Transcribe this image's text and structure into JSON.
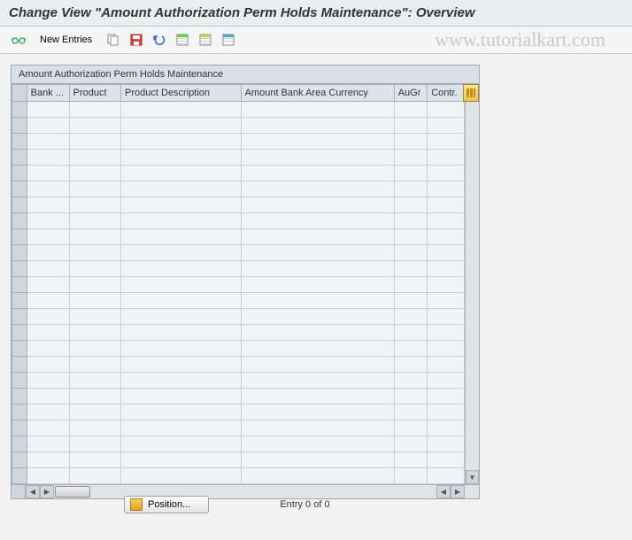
{
  "title": "Change View \"Amount Authorization Perm Holds Maintenance\": Overview",
  "toolbar": {
    "new_entries_label": "New Entries"
  },
  "watermark": "www.tutorialkart.com",
  "grid": {
    "title": "Amount Authorization Perm Holds Maintenance",
    "columns": [
      "Bank ...",
      "Product",
      "Product Description",
      "Amount Bank Area Currency",
      "AuGr",
      "Contr."
    ],
    "empty_rows": 24
  },
  "footer": {
    "position_label": "Position...",
    "entry_label": "Entry 0 of 0"
  }
}
